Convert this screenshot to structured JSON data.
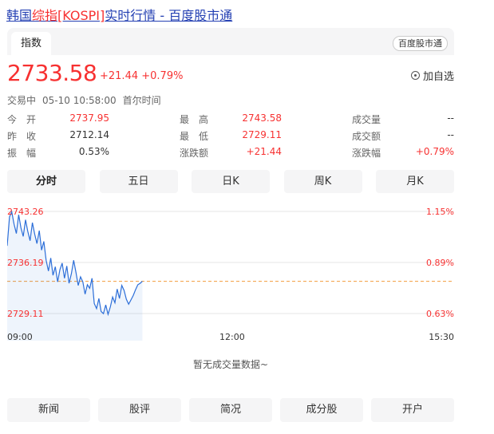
{
  "title": {
    "prefix": "韩国",
    "highlight": "综指",
    "link_highlight": "[KOSPI]",
    "suffix": "实时行情 - 百度股市通"
  },
  "tabs": {
    "active": "指数"
  },
  "source_badge": "百度股市通",
  "quote": {
    "price": "2733.58",
    "change": "+21.44",
    "change_pct": "+0.79%",
    "watch_label": "加自选"
  },
  "status": {
    "state": "交易中",
    "time": "05-10 10:58:00",
    "zone": "首尔时间"
  },
  "stats": [
    [
      {
        "label": "今　开",
        "value": "2737.95",
        "color": "red"
      },
      {
        "label": "最　高",
        "value": "2743.58",
        "color": "red"
      },
      {
        "label": "成交量",
        "value": "--",
        "color": "dark"
      }
    ],
    [
      {
        "label": "昨　收",
        "value": "2712.14",
        "color": "dark"
      },
      {
        "label": "最　低",
        "value": "2729.11",
        "color": "red"
      },
      {
        "label": "成交额",
        "value": "--",
        "color": "dark"
      }
    ],
    [
      {
        "label": "振　幅",
        "value": "0.53%",
        "color": "dark"
      },
      {
        "label": "涨跌额",
        "value": "+21.44",
        "color": "red"
      },
      {
        "label": "涨跌幅",
        "value": "+0.79%",
        "color": "red"
      }
    ]
  ],
  "periods": [
    "分时",
    "五日",
    "日K",
    "周K",
    "月K"
  ],
  "chart_data": {
    "type": "line",
    "y_left_ticks": [
      "2743.26",
      "2736.19",
      "2729.11"
    ],
    "y_right_ticks": [
      "1.15%",
      "0.89%",
      "0.63%"
    ],
    "x_ticks": [
      "09:00",
      "12:00",
      "15:30"
    ],
    "reference_line": 2712.14,
    "series": [
      {
        "x_minutes": [
          0,
          2,
          4,
          6,
          8,
          10,
          12,
          14,
          16,
          18,
          20,
          22,
          24,
          26,
          28,
          30,
          32,
          34,
          36,
          38,
          40,
          42,
          44,
          46,
          48,
          50,
          52,
          54,
          56,
          58,
          60,
          62,
          64,
          66,
          68,
          70,
          72,
          74,
          76,
          78,
          80,
          82,
          84,
          86,
          88,
          90,
          92,
          94,
          96,
          98,
          100,
          102,
          104,
          106,
          108,
          110,
          112,
          114,
          116,
          118
        ],
        "values": [
          2738.5,
          2742.5,
          2743.2,
          2741.5,
          2740.2,
          2742.8,
          2741.0,
          2739.8,
          2742.1,
          2740.5,
          2739.2,
          2741.7,
          2740.1,
          2738.8,
          2740.6,
          2737.9,
          2739.1,
          2736.5,
          2735.0,
          2736.8,
          2734.4,
          2735.6,
          2733.5,
          2735.2,
          2736.1,
          2734.0,
          2735.7,
          2733.3,
          2734.6,
          2736.5,
          2734.8,
          2733.0,
          2734.2,
          2733.5,
          2731.8,
          2733.1,
          2732.6,
          2734.0,
          2730.5,
          2729.8,
          2731.2,
          2729.4,
          2729.1,
          2730.3,
          2729.0,
          2730.0,
          2731.4,
          2730.6,
          2732.5,
          2731.2,
          2733.0,
          2732.3,
          2731.1,
          2730.4,
          2731.0,
          2731.6,
          2732.4,
          2733.1,
          2733.3,
          2733.58
        ],
        "color": "#2c6ed8"
      }
    ]
  },
  "no_volume": "暂无成交量数据~",
  "bottom_tabs": [
    "新闻",
    "股评",
    "简况",
    "成分股",
    "开户"
  ]
}
